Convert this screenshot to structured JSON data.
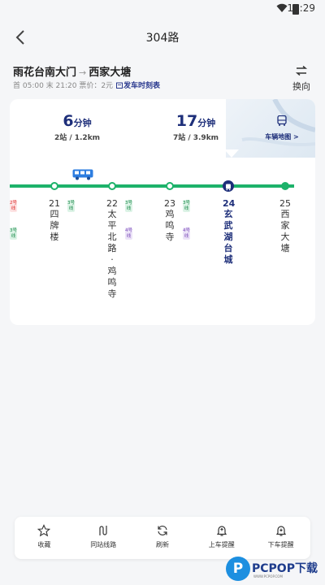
{
  "status_bar": {
    "time": "10:29"
  },
  "header": {
    "title": "304路"
  },
  "route": {
    "from": "雨花台南大门",
    "arrow": "→",
    "to": "西家大塘",
    "info": "首 05:00 末 21:20 票价：2元",
    "timetable_label": "发车时刻表",
    "switch_label": "换向"
  },
  "eta": [
    {
      "minutes": "6",
      "unit": "分钟",
      "distance": "2站 / 1.2km"
    },
    {
      "minutes": "17",
      "unit": "分钟",
      "distance": "7站 / 3.9km"
    }
  ],
  "map_button": {
    "label": "车辆地图 >"
  },
  "stops": [
    {
      "num": "21",
      "name": "四牌楼",
      "tags": [
        "3号线"
      ]
    },
    {
      "num": "22",
      "name": "太平北路·鸡鸣寺",
      "tags": [
        "3号线",
        "4号线"
      ]
    },
    {
      "num": "23",
      "name": "鸡鸣寺",
      "tags": [
        "3号线",
        "4号线"
      ]
    },
    {
      "num": "24",
      "name": "玄武湖台城",
      "tags": []
    },
    {
      "num": "25",
      "name": "西家大塘",
      "tags": []
    }
  ],
  "left_tags": [
    "2号线",
    "3号线"
  ],
  "bottom_nav": [
    {
      "label": "收藏",
      "icon": "star-icon"
    },
    {
      "label": "同站线路",
      "icon": "route-icon"
    },
    {
      "label": "刷新",
      "icon": "refresh-icon"
    },
    {
      "label": "上车提醒",
      "icon": "bell-icon"
    },
    {
      "label": "下车提醒",
      "icon": "bell-icon"
    }
  ],
  "watermark": {
    "logo": "P",
    "text": "PCPOP下载",
    "sub": "WWW.PCPOP.COM"
  },
  "colors": {
    "accent": "#1e2f7a",
    "line": "#1db26a"
  }
}
